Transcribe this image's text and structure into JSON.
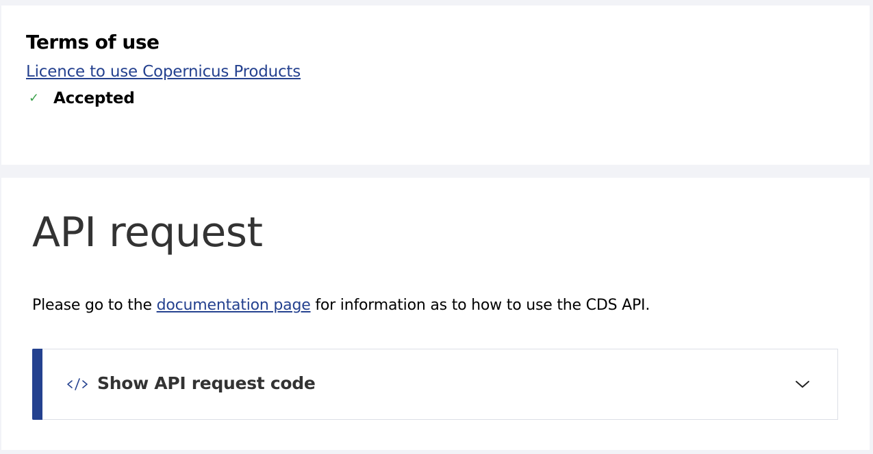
{
  "terms": {
    "title": "Terms of use",
    "licence_link": "Licence to use Copernicus Products",
    "status": "Accepted",
    "status_icon": "check-icon",
    "status_color": "#3aa14a"
  },
  "api": {
    "title": "API request",
    "description_before": "Please go to the ",
    "description_link": "documentation page",
    "description_after": " for information as to how to use the CDS API.",
    "accordion_label": "Show API request code",
    "accordion_icon": "code-icon",
    "accordion_toggle_icon": "chevron-down-icon"
  },
  "colors": {
    "link": "#24418f",
    "accent": "#24418f",
    "background": "#f2f3f7",
    "panel": "#ffffff",
    "heading": "#333333"
  }
}
